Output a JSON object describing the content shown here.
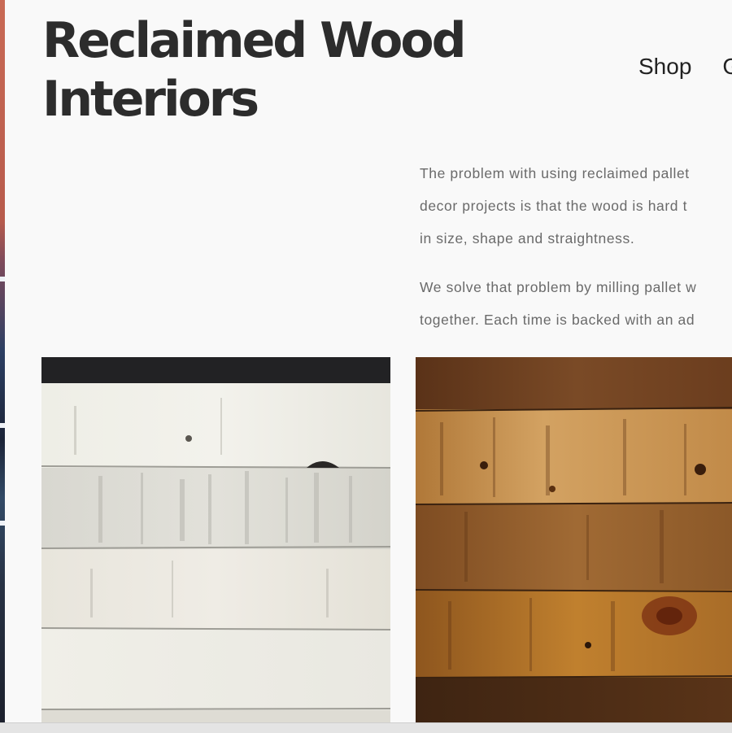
{
  "site": {
    "title": "Reclaimed Wood Interiors"
  },
  "nav": {
    "items": [
      {
        "label": "Shop"
      },
      {
        "label": "G"
      }
    ]
  },
  "intro": {
    "paragraph_1_lines": [
      "The problem with using reclaimed pallet",
      "decor projects is that the wood is hard t",
      "in size, shape and straightness."
    ],
    "paragraph_2_lines": [
      "We solve that problem by milling pallet w",
      "together. Each time is backed with an ad"
    ]
  },
  "gallery": {
    "items": [
      {
        "name": "whitewashed-pallet-wood-panel",
        "finish": "whitewash"
      },
      {
        "name": "stained-pallet-wood-panel",
        "finish": "stain"
      }
    ]
  }
}
